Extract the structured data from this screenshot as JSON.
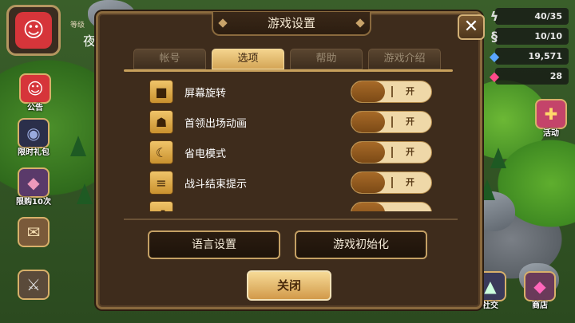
{
  "hud": {
    "level_label": "等级",
    "player_char": "夜"
  },
  "left_menu": [
    {
      "label": "公告",
      "icon": "notice-face-icon",
      "color": "#d6353a"
    },
    {
      "label": "限时礼包",
      "icon": "demon-bag-icon",
      "color": "#2b2f4a"
    },
    {
      "label": "限购10次",
      "icon": "crystal-icon",
      "color": "#5a3a6a"
    },
    {
      "label": "",
      "icon": "scroll-icon",
      "color": "#7a5a3a"
    },
    {
      "label": "",
      "icon": "crossed-swords-icon",
      "color": "#5a4a3a"
    }
  ],
  "resources": [
    {
      "value": "40/35",
      "icon": "energy-bolt-icon"
    },
    {
      "value": "10/10",
      "icon": "swirl-icon"
    },
    {
      "value": "19,571",
      "icon": "blue-crystal-icon"
    },
    {
      "value": "28",
      "icon": "red-crystal-icon"
    }
  ],
  "right_menu": {
    "event_label": "活动",
    "social_label": "社交",
    "shop_label": "商店"
  },
  "dialog": {
    "title": "游戏设置",
    "close_label": "✕",
    "tabs": [
      {
        "label": "帐号",
        "active": false
      },
      {
        "label": "选项",
        "active": true
      },
      {
        "label": "帮助",
        "active": false
      },
      {
        "label": "游戏介绍",
        "active": false
      }
    ],
    "settings": [
      {
        "label": "屏幕旋转",
        "state": "开",
        "icon": "camera-icon"
      },
      {
        "label": "首领出场动画",
        "state": "开",
        "icon": "boss-icon"
      },
      {
        "label": "省电模式",
        "state": "开",
        "icon": "moon-icon"
      },
      {
        "label": "战斗结束提示",
        "state": "开",
        "icon": "alert-bars-icon"
      },
      {
        "label": "",
        "state": "",
        "icon": "lowres-icon"
      }
    ],
    "language_button": "语言设置",
    "reset_button": "游戏初始化",
    "close_button": "关闭"
  },
  "colors": {
    "dialog_bg": "#3e2c1c",
    "accent_gold": "#c8a15c",
    "toggle_on": "#a76a28"
  }
}
